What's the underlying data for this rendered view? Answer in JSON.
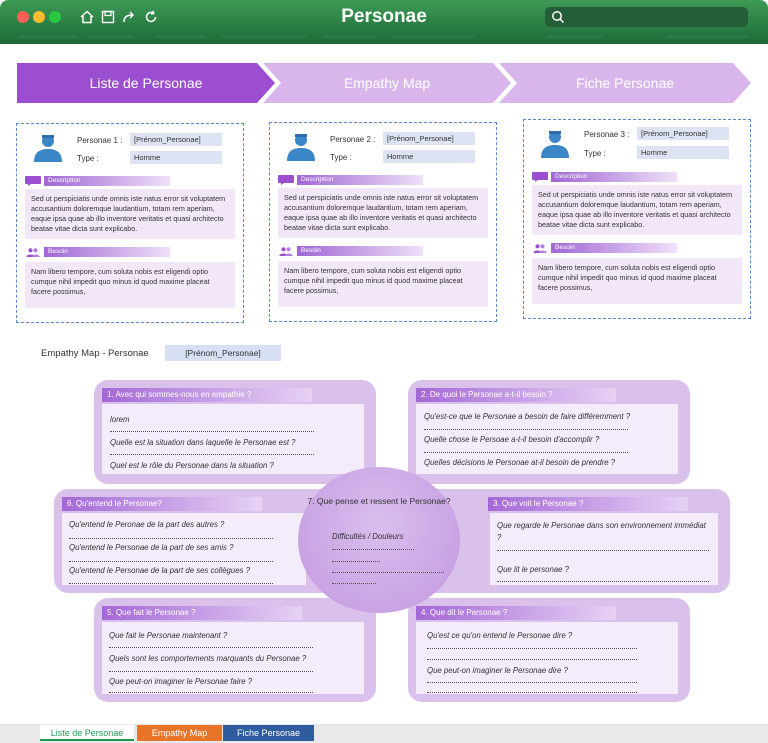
{
  "app": {
    "title": "Personae"
  },
  "steps": [
    "Liste de Personae",
    "Empathy Map",
    "Fiche Personae"
  ],
  "personas": [
    {
      "label": "Personae 1 :",
      "name": "[Prénom_Personae]",
      "type_label": "Type :",
      "type": "Homme",
      "desc_label": "Description",
      "description": "Sed ut perspiciatis unde omnis iste natus error sit voluptatem accusantium doloremque laudantium, totam rem aperiam, eaque ipsa quae ab illo inventore veritatis et quasi architecto beatae vitae dicta sunt explicabo.",
      "need_label": "Besoin",
      "need": "Nam libero tempore, cum soluta nobis est eligendi optio cumque nihil impedit quo minus id quod maxime placeat facere possimus,"
    },
    {
      "label": "Personae 2 :",
      "name": "[Prénom_Personae]",
      "type_label": "Type :",
      "type": "Homme",
      "desc_label": "Description",
      "description": "Sed ut perspiciatis unde omnis iste natus error sit voluptatem accusantium doloremque laudantium, totam rem aperiam, eaque ipsa quae ab illo inventore veritatis et quasi architecto beatae vitae dicta sunt explicabo.",
      "need_label": "Besoin",
      "need": "Nam libero tempore, cum soluta nobis est eligendi optio cumque nihil impedit quo minus id quod maxime placeat facere possimus,"
    },
    {
      "label": "Personae 3 :",
      "name": "[Prénom_Personae]",
      "type_label": "Type :",
      "type": "Homme",
      "desc_label": "Description",
      "description": "Sed ut perspiciatis unde omnis iste natus error sit voluptatem accusantium doloremque laudantium, totam rem aperiam, eaque ipsa quae ab illo inventore veritatis et quasi architecto beatae vitae dicta sunt explicabo.",
      "need_label": "Besoin",
      "need": "Nam libero tempore, cum soluta nobis est eligendi optio cumque nihil impedit quo minus id quod maxime placeat facere possimus,"
    }
  ],
  "empathy": {
    "title": "Empathy Map - Personae",
    "name": "[Prénom_Personae]",
    "q1": {
      "title": "1. Avec qui sommes-nous en empathie ?",
      "items": [
        "lorem",
        "Quelle est la situation dans laquelle le Personae est ?",
        "Quel est le rôle du Personae dans la situation ?"
      ]
    },
    "q2": {
      "title": "2. De quoi le Personae a-t-il besoin ?",
      "items": [
        "Qu'est-ce que le Personae a besoin de faire différemment ?",
        "Quelle chose le Persoae a-t-il besoin d'accomplir ?",
        "Quelles décisions le Personae at-il besoin de prendre ?"
      ]
    },
    "q3": {
      "title": "3. Que voit le Personae ?",
      "items": [
        "Que regarde le Personae dans son environnement immédiat ?",
        "Que lit le personae ?"
      ]
    },
    "q4": {
      "title": "4. Que dit le Personae ?",
      "items": [
        "Qu'est ce qu'on entend le Personae dire ?",
        "Que peut-on imaginer le Personae dire ?"
      ]
    },
    "q5": {
      "title": "5. Que fait le Personae ?",
      "items": [
        "Que fait le Personae maintenant ?",
        "Quels sont les comportements marquants du Personae ?",
        "Que peut-on imaginer le Personae faire ?"
      ]
    },
    "q6": {
      "title": "6. Qu'entend le Personae?",
      "items": [
        "Qu'entend le Peronae de la part des autres ?",
        "Qu'entend le Personae de la part de ses amis ?",
        "Qu'entend le Personae de la part de ses collègues ?"
      ]
    },
    "q7": {
      "title": "7. Que pense et ressent le Personae?",
      "items": [
        "Difficultés / Douleurs"
      ]
    }
  },
  "sheets": [
    "Liste de Personae",
    "Empathy Map",
    "Fiche Personae"
  ],
  "colors": {
    "titlebar": "#2d8a4a",
    "accent": "#9b4fd0",
    "quadrant": "#d9c1ec"
  },
  "icons": [
    "home-icon",
    "save-icon",
    "share-icon",
    "refresh-icon",
    "search-icon",
    "user-icon",
    "speech-icon",
    "group-icon"
  ]
}
